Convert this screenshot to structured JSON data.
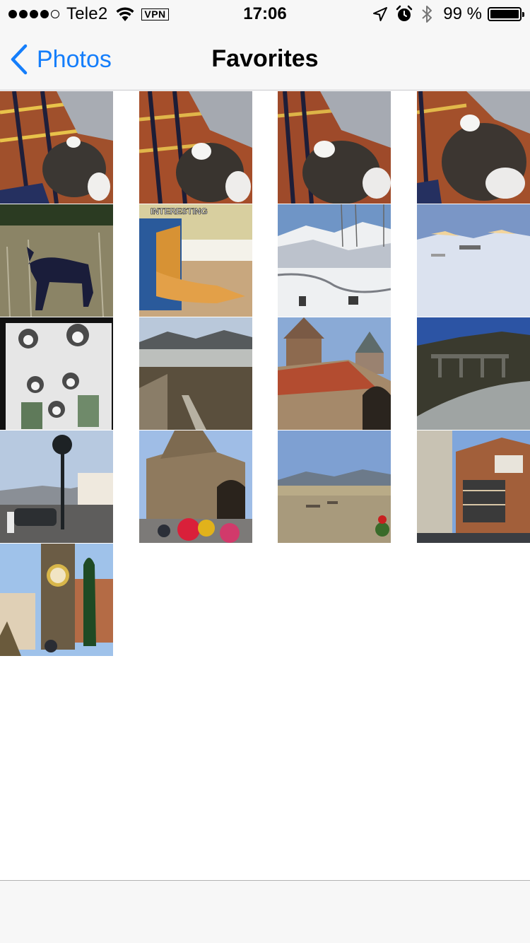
{
  "status_bar": {
    "carrier": "Tele2",
    "vpn": "VPN",
    "time": "17:06",
    "battery_text": "99 %",
    "battery_level": 0.99,
    "signal_strength": 4,
    "icons": [
      "signal-icon",
      "wifi-icon",
      "vpn-badge",
      "location-icon",
      "alarm-icon",
      "bluetooth-icon",
      "battery-icon"
    ]
  },
  "nav": {
    "back_label": "Photos",
    "title": "Favorites"
  },
  "grid": {
    "photos": [
      {
        "subject": "cat on plaid blanket"
      },
      {
        "subject": "cat on plaid blanket"
      },
      {
        "subject": "cat on plaid blanket"
      },
      {
        "subject": "cat on plaid blanket"
      },
      {
        "subject": "black wolf in grass"
      },
      {
        "subject": "cat in box meme",
        "caption": "INTERESTING"
      },
      {
        "subject": "snowy mountains"
      },
      {
        "subject": "snowy field at sunrise"
      },
      {
        "subject": "skeleton mariachi artwork"
      },
      {
        "subject": "mountain valley with river"
      },
      {
        "subject": "stone church with tiled roof"
      },
      {
        "subject": "bridge over gorge"
      },
      {
        "subject": "street with lamp post"
      },
      {
        "subject": "stone church with tourists"
      },
      {
        "subject": "courtyard with mountains"
      },
      {
        "subject": "old wooden balcony house"
      },
      {
        "subject": "clock tower"
      }
    ]
  },
  "colors": {
    "accent": "#157efb",
    "bar_background": "#f7f7f7",
    "separator": "#c8c8cc"
  }
}
